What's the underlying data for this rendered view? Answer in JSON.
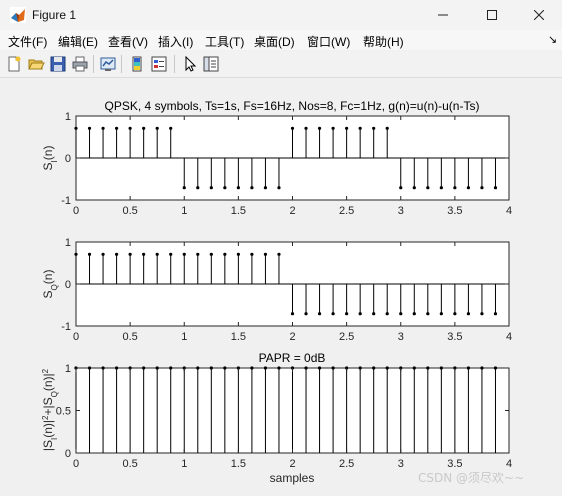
{
  "window": {
    "title": "Figure 1",
    "menu": [
      "文件(F)",
      "编辑(E)",
      "查看(V)",
      "插入(I)",
      "工具(T)",
      "桌面(D)",
      "窗口(W)",
      "帮助(H)"
    ],
    "menu_overflow": "↘"
  },
  "toolbar": {
    "icons": [
      "new-figure-icon",
      "open-file-icon",
      "save-icon",
      "print-icon",
      "link-plot-icon",
      "insert-colorbar-icon",
      "insert-legend-icon",
      "pointer-icon",
      "property-editor-icon"
    ]
  },
  "watermark": "CSDN @须尽欢~~",
  "chart_data": [
    {
      "type": "stem",
      "title": "QPSK, 4 symbols, Ts=1s, Fs=16Hz, Nos=8, Fc=1Hz, g(n)=u(n)-u(n-Ts)",
      "ylabel": "S_I(n)",
      "xlim": [
        0,
        4
      ],
      "ylim": [
        -1,
        1
      ],
      "xticks": [
        "0",
        "0.5",
        "1",
        "1.5",
        "2",
        "2.5",
        "3",
        "3.5",
        "4"
      ],
      "yticks": [
        "-1",
        "0",
        "1"
      ],
      "x": [
        0,
        0.125,
        0.25,
        0.375,
        0.5,
        0.625,
        0.75,
        0.875,
        1,
        1.125,
        1.25,
        1.375,
        1.5,
        1.625,
        1.75,
        1.875,
        2,
        2.125,
        2.25,
        2.375,
        2.5,
        2.625,
        2.75,
        2.875,
        3,
        3.125,
        3.25,
        3.375,
        3.5,
        3.625,
        3.75,
        3.875
      ],
      "y": [
        0.707,
        0.707,
        0.707,
        0.707,
        0.707,
        0.707,
        0.707,
        0.707,
        -0.707,
        -0.707,
        -0.707,
        -0.707,
        -0.707,
        -0.707,
        -0.707,
        -0.707,
        0.707,
        0.707,
        0.707,
        0.707,
        0.707,
        0.707,
        0.707,
        0.707,
        -0.707,
        -0.707,
        -0.707,
        -0.707,
        -0.707,
        -0.707,
        -0.707,
        -0.707
      ]
    },
    {
      "type": "stem",
      "title": "",
      "ylabel": "S_Q(n)",
      "xlim": [
        0,
        4
      ],
      "ylim": [
        -1,
        1
      ],
      "xticks": [
        "0",
        "0.5",
        "1",
        "1.5",
        "2",
        "2.5",
        "3",
        "3.5",
        "4"
      ],
      "yticks": [
        "-1",
        "0",
        "1"
      ],
      "x": [
        0,
        0.125,
        0.25,
        0.375,
        0.5,
        0.625,
        0.75,
        0.875,
        1,
        1.125,
        1.25,
        1.375,
        1.5,
        1.625,
        1.75,
        1.875,
        2,
        2.125,
        2.25,
        2.375,
        2.5,
        2.625,
        2.75,
        2.875,
        3,
        3.125,
        3.25,
        3.375,
        3.5,
        3.625,
        3.75,
        3.875
      ],
      "y": [
        0.707,
        0.707,
        0.707,
        0.707,
        0.707,
        0.707,
        0.707,
        0.707,
        0.707,
        0.707,
        0.707,
        0.707,
        0.707,
        0.707,
        0.707,
        0.707,
        -0.707,
        -0.707,
        -0.707,
        -0.707,
        -0.707,
        -0.707,
        -0.707,
        -0.707,
        -0.707,
        -0.707,
        -0.707,
        -0.707,
        -0.707,
        -0.707,
        -0.707,
        -0.707
      ]
    },
    {
      "type": "stem",
      "title": "PAPR = 0dB",
      "ylabel": "|S_I(n)|^2+|S_Q(n)|^2",
      "xlabel": "samples",
      "xlim": [
        0,
        4
      ],
      "ylim": [
        0,
        1
      ],
      "xticks": [
        "0",
        "0.5",
        "1",
        "1.5",
        "2",
        "2.5",
        "3",
        "3.5",
        "4"
      ],
      "yticks": [
        "0",
        "0.5",
        "1"
      ],
      "x": [
        0,
        0.125,
        0.25,
        0.375,
        0.5,
        0.625,
        0.75,
        0.875,
        1,
        1.125,
        1.25,
        1.375,
        1.5,
        1.625,
        1.75,
        1.875,
        2,
        2.125,
        2.25,
        2.375,
        2.5,
        2.625,
        2.75,
        2.875,
        3,
        3.125,
        3.25,
        3.375,
        3.5,
        3.625,
        3.75,
        3.875
      ],
      "y": [
        1,
        1,
        1,
        1,
        1,
        1,
        1,
        1,
        1,
        1,
        1,
        1,
        1,
        1,
        1,
        1,
        1,
        1,
        1,
        1,
        1,
        1,
        1,
        1,
        1,
        1,
        1,
        1,
        1,
        1,
        1,
        1
      ]
    }
  ]
}
